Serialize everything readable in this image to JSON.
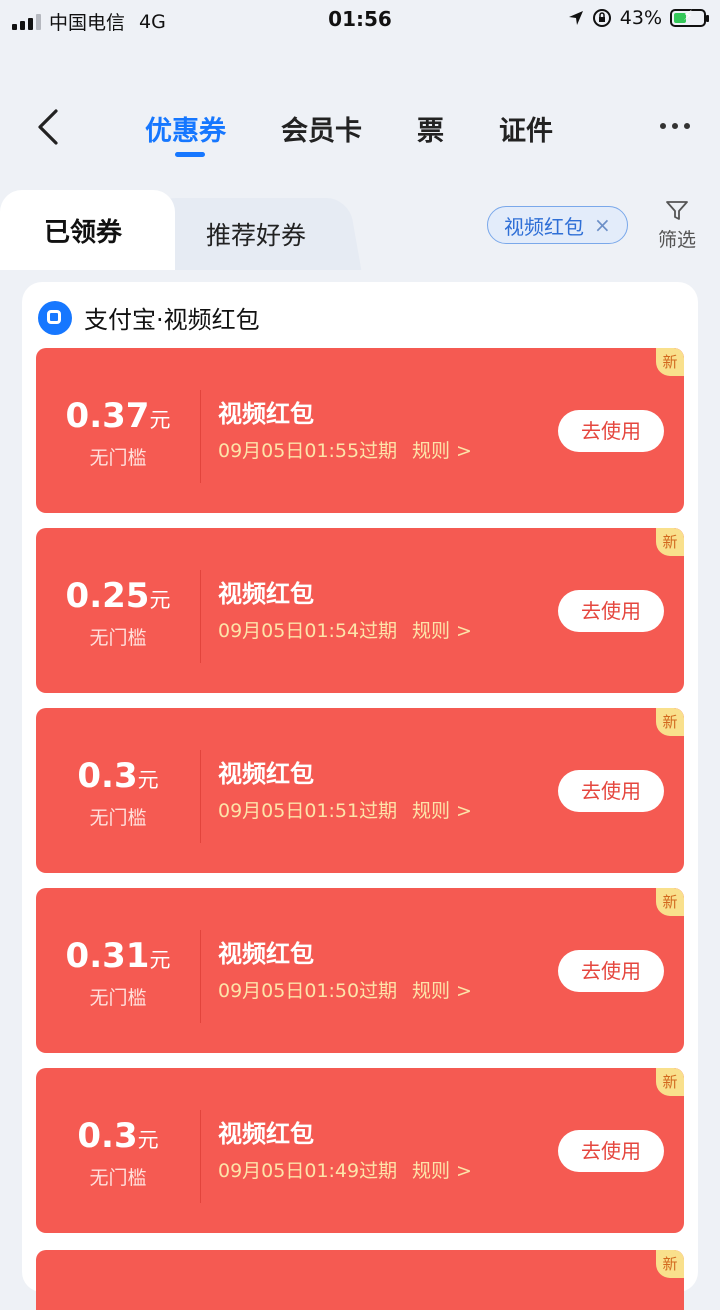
{
  "status_bar": {
    "carrier": "中国电信",
    "network": "4G",
    "time": "01:56",
    "battery_pct": "43%",
    "battery_level": 0.43
  },
  "nav": {
    "tabs": [
      "优惠券",
      "会员卡",
      "票",
      "证件"
    ],
    "active_tab": 0
  },
  "subtabs": {
    "claimed": "已领券",
    "recommended": "推荐好券",
    "filter_chip": "视频红包",
    "filter_chip_close": "×",
    "filter_label": "筛选"
  },
  "merchant": {
    "name": "支付宝·视频红包"
  },
  "coupons": [
    {
      "amount": "0.37",
      "unit": "元",
      "threshold": "无门槛",
      "title": "视频红包",
      "expire": "09月05日01:55过期",
      "rule": "规则 >",
      "action": "去使用",
      "badge": "新"
    },
    {
      "amount": "0.25",
      "unit": "元",
      "threshold": "无门槛",
      "title": "视频红包",
      "expire": "09月05日01:54过期",
      "rule": "规则 >",
      "action": "去使用",
      "badge": "新"
    },
    {
      "amount": "0.3",
      "unit": "元",
      "threshold": "无门槛",
      "title": "视频红包",
      "expire": "09月05日01:51过期",
      "rule": "规则 >",
      "action": "去使用",
      "badge": "新"
    },
    {
      "amount": "0.31",
      "unit": "元",
      "threshold": "无门槛",
      "title": "视频红包",
      "expire": "09月05日01:50过期",
      "rule": "规则 >",
      "action": "去使用",
      "badge": "新"
    },
    {
      "amount": "0.3",
      "unit": "元",
      "threshold": "无门槛",
      "title": "视频红包",
      "expire": "09月05日01:49过期",
      "rule": "规则 >",
      "action": "去使用",
      "badge": "新"
    }
  ],
  "partial_badge": "新",
  "colors": {
    "accent": "#1677ff",
    "coupon_bg": "#f55a52",
    "expire_text": "#fde3a9",
    "badge_bg": "#f9e08c"
  }
}
